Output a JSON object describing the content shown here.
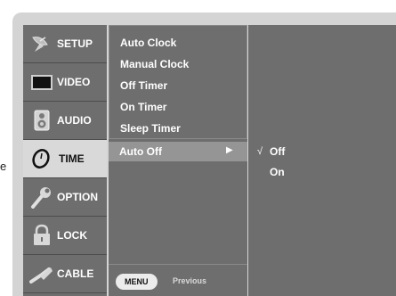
{
  "stray_text": "e",
  "sidebar": {
    "items": [
      {
        "label": "SETUP",
        "icon": "satellite-dish-icon"
      },
      {
        "label": "VIDEO",
        "icon": "tv-screen-icon"
      },
      {
        "label": "AUDIO",
        "icon": "speaker-icon"
      },
      {
        "label": "TIME",
        "icon": "clock-icon"
      },
      {
        "label": "OPTION",
        "icon": "wrench-icon"
      },
      {
        "label": "LOCK",
        "icon": "padlock-icon"
      },
      {
        "label": "CABLE",
        "icon": "cable-plug-icon"
      }
    ],
    "active": "TIME"
  },
  "time_menu": {
    "items": [
      "Auto Clock",
      "Manual Clock",
      "Off Timer",
      "On Timer",
      "Sleep Timer"
    ],
    "selected": "Auto Off",
    "selected_arrow": "▶"
  },
  "options": {
    "items": [
      "Off",
      "On"
    ],
    "checkmark": "√",
    "checked": "Off"
  },
  "footer": {
    "menu_key": "MENU",
    "hint": "Previous"
  },
  "colors": {
    "panel": "#6e6e6e",
    "frame": "#d4d4d4",
    "highlight": "#959595",
    "active_tab": "#d9d9d9"
  }
}
